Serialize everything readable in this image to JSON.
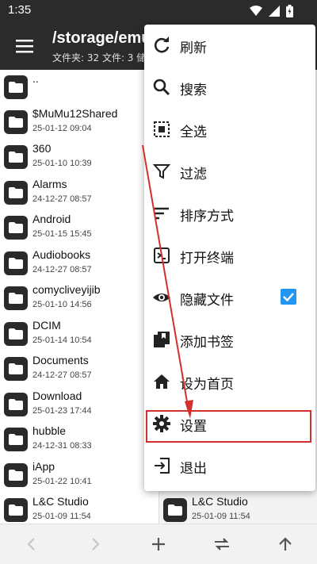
{
  "status_bar": {
    "time": "1:35"
  },
  "app_bar": {
    "title": "/storage/emu",
    "subtitle": "文件夹: 32  文件: 3  储"
  },
  "left_pane": {
    "items": [
      {
        "name": "..",
        "date": ""
      },
      {
        "name": "$MuMu12Shared",
        "date": "25-01-12 09:04"
      },
      {
        "name": "360",
        "date": "25-01-10 10:39"
      },
      {
        "name": "Alarms",
        "date": "24-12-27 08:57"
      },
      {
        "name": "Android",
        "date": "25-01-15 15:45"
      },
      {
        "name": "Audiobooks",
        "date": "24-12-27 08:57"
      },
      {
        "name": "comycliveyijib",
        "date": "25-01-10 14:56"
      },
      {
        "name": "DCIM",
        "date": "25-01-14 10:54"
      },
      {
        "name": "Documents",
        "date": "24-12-27 08:57"
      },
      {
        "name": "Download",
        "date": "25-01-23 17:44"
      },
      {
        "name": "hubble",
        "date": "24-12-31 08:33"
      },
      {
        "name": "iApp",
        "date": "25-01-22 10:41"
      },
      {
        "name": "L&C Studio",
        "date": "25-01-09 11:54"
      }
    ]
  },
  "right_pane": {
    "items": [
      {
        "name": "L&C Studio",
        "date": "25-01-09 11:54"
      }
    ]
  },
  "menu": {
    "items": [
      {
        "label": "刷新",
        "icon": "refresh-icon"
      },
      {
        "label": "搜索",
        "icon": "search-icon"
      },
      {
        "label": "全选",
        "icon": "select-all-icon"
      },
      {
        "label": "过滤",
        "icon": "filter-icon"
      },
      {
        "label": "排序方式",
        "icon": "sort-icon"
      },
      {
        "label": "打开终端",
        "icon": "terminal-icon"
      },
      {
        "label": "隐藏文件",
        "icon": "eye-icon",
        "checked": true
      },
      {
        "label": "添加书签",
        "icon": "bookmark-icon"
      },
      {
        "label": "设为首页",
        "icon": "home-icon"
      },
      {
        "label": "设置",
        "icon": "gear-icon",
        "highlighted": true
      },
      {
        "label": "退出",
        "icon": "exit-icon"
      }
    ]
  },
  "bottom_bar": {
    "icons": [
      "back-icon",
      "forward-icon",
      "add-icon",
      "swap-icon",
      "up-icon"
    ]
  },
  "colors": {
    "app_bar": "#2b2b2b",
    "checkbox": "#2196f3",
    "annotation": "#d32f2f"
  }
}
